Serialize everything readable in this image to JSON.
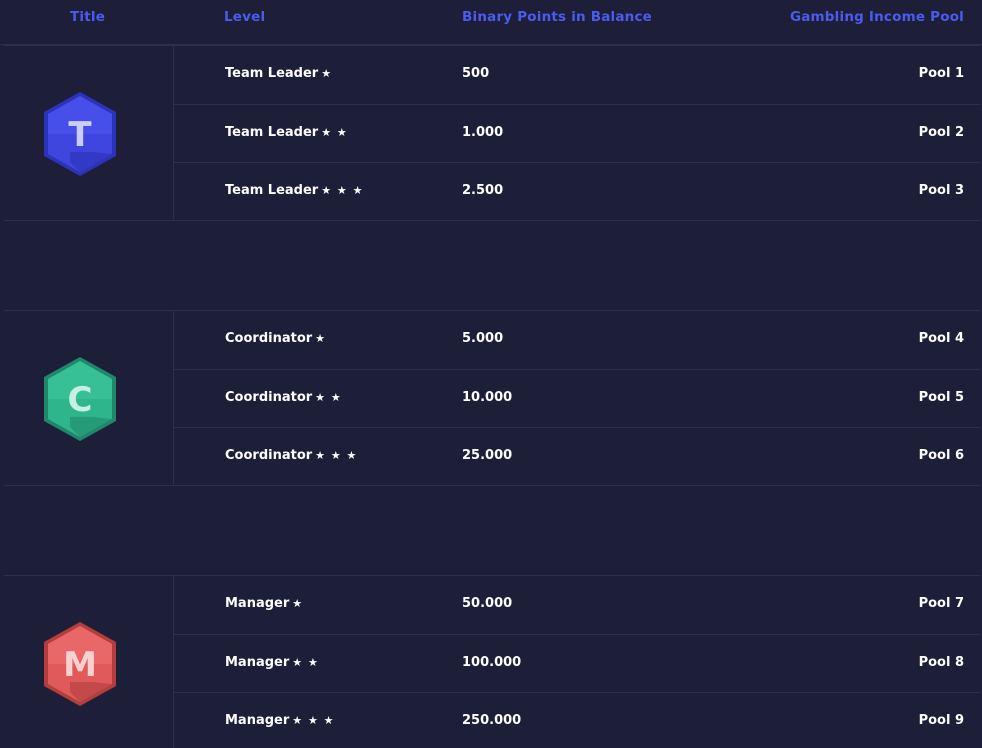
{
  "header": {
    "title": "Title",
    "level": "Level",
    "points": "Binary Points in Balance",
    "pool": "Gambling Income Pool"
  },
  "groups": [
    {
      "badge_letter": "T",
      "badge_color": "#3f46e0",
      "rows": [
        {
          "level": "Team Leader",
          "stars": "★",
          "points": "500",
          "pool": "Pool 1"
        },
        {
          "level": "Team Leader",
          "stars": "★ ★",
          "points": "1.000",
          "pool": "Pool 2"
        },
        {
          "level": "Team Leader",
          "stars": "★ ★ ★",
          "points": "2.500",
          "pool": "Pool 3"
        }
      ]
    },
    {
      "badge_letter": "C",
      "badge_color": "#2fb58c",
      "rows": [
        {
          "level": "Coordinator",
          "stars": "★",
          "points": "5.000",
          "pool": "Pool 4"
        },
        {
          "level": "Coordinator",
          "stars": "★ ★",
          "points": "10.000",
          "pool": "Pool 5"
        },
        {
          "level": "Coordinator",
          "stars": "★ ★ ★",
          "points": "25.000",
          "pool": "Pool 6"
        }
      ]
    },
    {
      "badge_letter": "M",
      "badge_color": "#e05a5a",
      "rows": [
        {
          "level": "Manager",
          "stars": "★",
          "points": "50.000",
          "pool": "Pool 7"
        },
        {
          "level": "Manager",
          "stars": "★ ★",
          "points": "100.000",
          "pool": "Pool 8"
        },
        {
          "level": "Manager",
          "stars": "★ ★ ★",
          "points": "250.000",
          "pool": "Pool 9"
        }
      ]
    }
  ]
}
